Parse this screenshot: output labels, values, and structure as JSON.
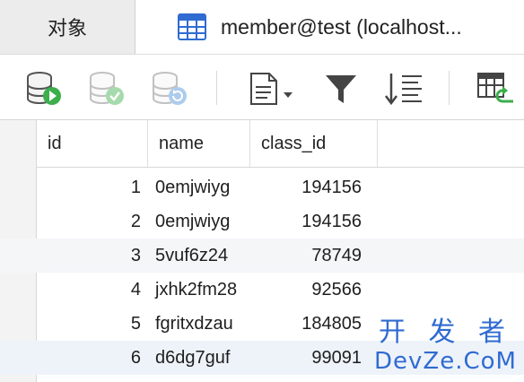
{
  "tabs": {
    "objects_label": "对象",
    "active_label": "member@test (localhost..."
  },
  "toolbar": {
    "buttons": [
      {
        "icon": "database-run-icon"
      },
      {
        "icon": "database-check-icon"
      },
      {
        "icon": "database-refresh-icon"
      },
      {
        "icon": "document-menu-icon"
      },
      {
        "icon": "filter-icon"
      },
      {
        "icon": "sort-icon"
      },
      {
        "icon": "table-import-icon"
      }
    ]
  },
  "grid": {
    "columns": [
      "id",
      "name",
      "class_id"
    ],
    "rows": [
      {
        "id": "1",
        "name": "0emjwiyg",
        "class_id": "194156"
      },
      {
        "id": "2",
        "name": "0emjwiyg",
        "class_id": "194156"
      },
      {
        "id": "3",
        "name": "5vuf6z24",
        "class_id": "78749"
      },
      {
        "id": "4",
        "name": "jxhk2fm28",
        "class_id": "92566"
      },
      {
        "id": "5",
        "name": "fgritxdzau",
        "class_id": "184805"
      },
      {
        "id": "6",
        "name": "d6dg7guf",
        "class_id": "99091"
      }
    ]
  },
  "watermark": {
    "line1": "开 发 者",
    "line2": "DevZe.CoM"
  },
  "colors": {
    "accent_blue": "#2f6bd1",
    "green": "#3cae4b",
    "selection_row": "#eef3fa"
  }
}
